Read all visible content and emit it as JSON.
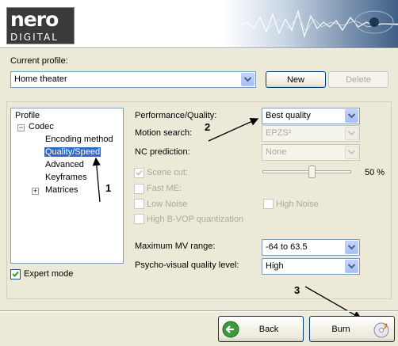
{
  "header": {
    "logo_line1": "nero",
    "logo_line2": "DIGITAL"
  },
  "profile": {
    "label": "Current profile:",
    "value": "Home theater",
    "new_label": "New",
    "delete_label": "Delete"
  },
  "tree": {
    "root": "Profile",
    "codec": "Codec",
    "items": [
      "Encoding method",
      "Quality/Speed",
      "Advanced",
      "Keyframes",
      "Matrices"
    ],
    "selected": "Quality/Speed"
  },
  "expert_mode": {
    "label": "Expert mode",
    "checked": true
  },
  "settings": {
    "performance_label": "Performance/Quality:",
    "performance_value": "Best quality",
    "motion_label": "Motion search:",
    "motion_value": "EPZS²",
    "nc_label": "NC prediction:",
    "nc_value": "None",
    "scene_cut_label": "Scene cut:",
    "scene_cut_percent": "50 %",
    "scene_cut_level": 0.5,
    "fast_me_label": "Fast ME:",
    "low_noise_label": "Low Noise",
    "high_noise_label": "High Noise",
    "bvop_label": "High B-VOP quantization",
    "mv_range_label": "Maximum MV range:",
    "mv_range_value": "-64 to 63.5",
    "psycho_label": "Psycho-visual quality level:",
    "psycho_value": "High"
  },
  "annotations": {
    "one": "1",
    "two": "2",
    "three": "3"
  },
  "footer": {
    "back_label": "Back",
    "burn_label": "Burn"
  }
}
